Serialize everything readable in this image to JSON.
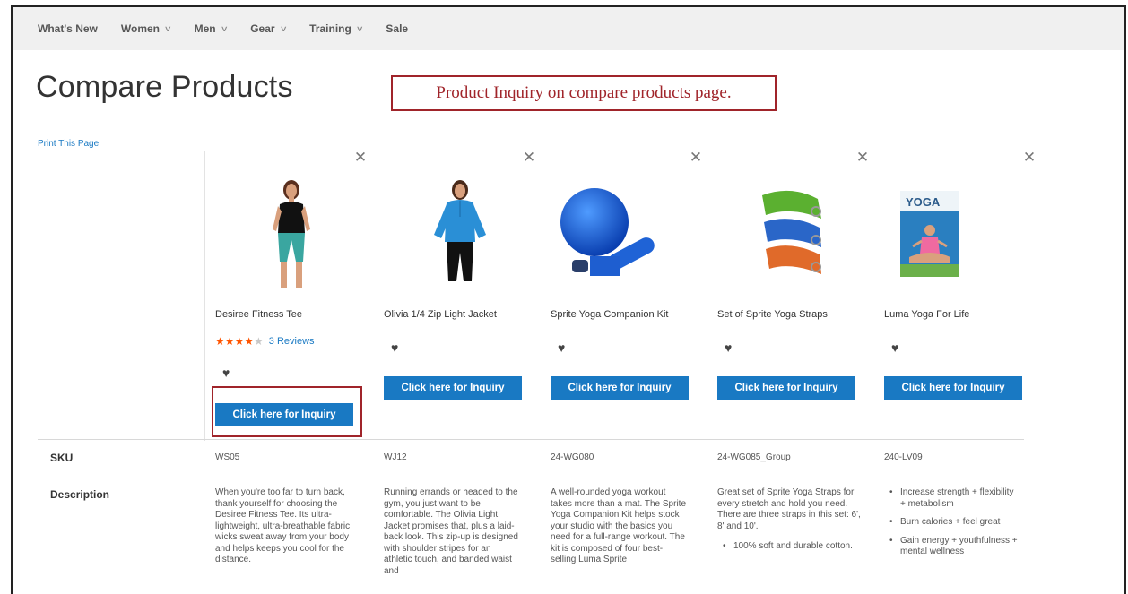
{
  "nav": {
    "items": [
      {
        "label": "What's New",
        "has_menu": false
      },
      {
        "label": "Women",
        "has_menu": true
      },
      {
        "label": "Men",
        "has_menu": true
      },
      {
        "label": "Gear",
        "has_menu": true
      },
      {
        "label": "Training",
        "has_menu": true
      },
      {
        "label": "Sale",
        "has_menu": false
      }
    ],
    "chevron_icon": "chevron-down-icon"
  },
  "page": {
    "title": "Compare Products",
    "callout": "Product Inquiry on compare products page.",
    "print_link": "Print This Page"
  },
  "colors": {
    "accent": "#1979c3",
    "callout": "#a0242a",
    "star": "#ff5501",
    "nav_bg": "#f0f0f0"
  },
  "products": [
    {
      "name": "Desiree Fitness Tee",
      "rating": 4,
      "stars": "★★★★",
      "stars_empty": "★",
      "reviews": "3 Reviews",
      "inquiry_button": "Click here for Inquiry",
      "sku": "WS05",
      "description": "When you're too far to turn back, thank yourself for choosing the Desiree Fitness Tee. Its ultra-lightweight, ultra-breathable fabric wicks sweat away from your body and helps keeps you cool for the distance.",
      "image": "woman-black-tee"
    },
    {
      "name": "Olivia 1/4 Zip Light Jacket",
      "inquiry_button": "Click here for Inquiry",
      "sku": "WJ12",
      "description": "Running errands or headed to the gym, you just want to be comfortable. The Olivia Light Jacket promises that, plus a laid-back look. This zip-up is designed with shoulder stripes for an athletic touch, and banded waist and",
      "image": "woman-blue-jacket"
    },
    {
      "name": "Sprite Yoga Companion Kit",
      "inquiry_button": "Click here for Inquiry",
      "sku": "24-WG080",
      "description": "A well-rounded yoga workout takes more than a mat. The Sprite Yoga Companion Kit helps stock your studio with the basics you need for a full-range workout. The kit is composed of four best-selling Luma Sprite",
      "image": "yoga-ball-kit"
    },
    {
      "name": "Set of Sprite Yoga Straps",
      "inquiry_button": "Click here for Inquiry",
      "sku": "24-WG085_Group",
      "description": "Great set of Sprite Yoga Straps for every stretch and hold you need. There are three straps in this set: 6', 8' and 10'.",
      "bullets": [
        "100% soft and durable cotton."
      ],
      "image": "yoga-straps"
    },
    {
      "name": "Luma Yoga For Life",
      "inquiry_button": "Click here for Inquiry",
      "sku": "240-LV09",
      "bullets": [
        "Increase strength + flexibility + metabolism",
        "Burn calories + feel great",
        "Gain energy + youthfulness + mental wellness"
      ],
      "image": "yoga-dvd",
      "dvd_text": "YOGA"
    }
  ],
  "rows": {
    "sku_label": "SKU",
    "description_label": "Description"
  },
  "icons": {
    "remove": "close-icon",
    "wishlist": "heart-icon",
    "rating": "star-icon"
  }
}
